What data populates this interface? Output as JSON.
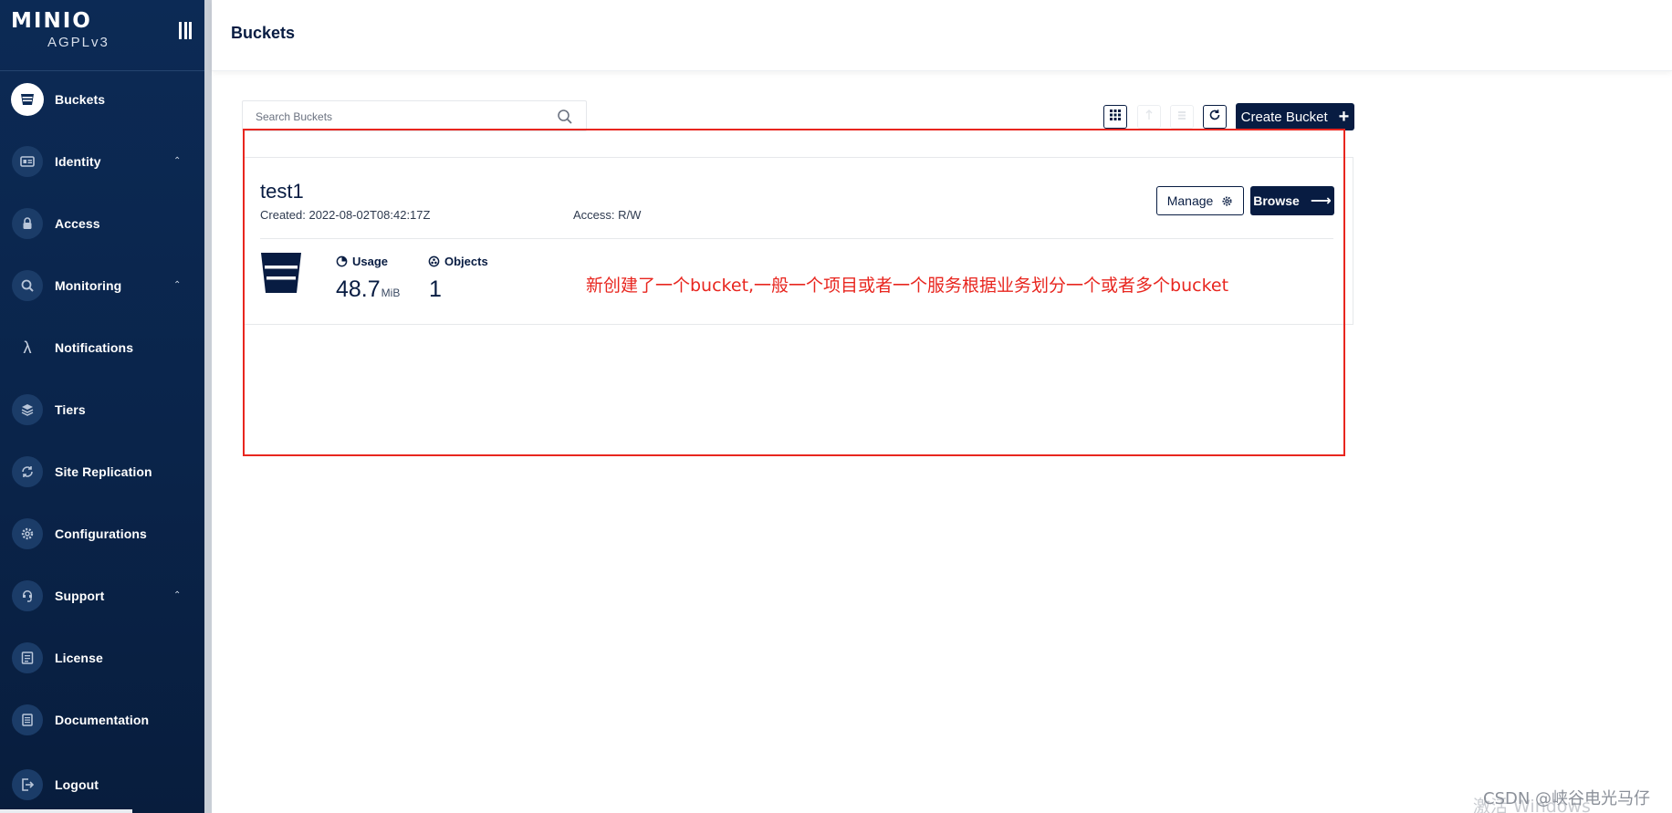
{
  "app": {
    "logo_text": "MINIO",
    "edition": "AGPLv3"
  },
  "sidebar": {
    "items": [
      {
        "label": "Buckets",
        "icon": "bucket-icon",
        "active": true
      },
      {
        "label": "Identity",
        "icon": "id-card-icon",
        "expandable": true
      },
      {
        "label": "Access",
        "icon": "lock-icon"
      },
      {
        "label": "Monitoring",
        "icon": "monitor-search-icon",
        "expandable": true
      },
      {
        "label": "Notifications",
        "icon": "lambda-icon"
      },
      {
        "label": "Tiers",
        "icon": "layers-icon"
      },
      {
        "label": "Site Replication",
        "icon": "sync-icon"
      },
      {
        "label": "Configurations",
        "icon": "gear-icon"
      },
      {
        "label": "Support",
        "icon": "support-icon",
        "expandable": true
      },
      {
        "label": "License",
        "icon": "license-icon"
      },
      {
        "label": "Documentation",
        "icon": "document-icon"
      },
      {
        "label": "Logout",
        "icon": "logout-icon"
      }
    ]
  },
  "header": {
    "title": "Buckets"
  },
  "toolbar": {
    "search_placeholder": "Search Buckets",
    "create_label": "Create Bucket"
  },
  "bucket": {
    "name": "test1",
    "created": "Created: 2022-08-02T08:42:17Z",
    "access": "Access: R/W",
    "manage_label": "Manage",
    "browse_label": "Browse",
    "usage_label": "Usage",
    "usage_value": "48.7",
    "usage_unit": "MiB",
    "objects_label": "Objects",
    "objects_value": "1"
  },
  "annotation": {
    "text": "新创建了一个bucket,一般一个项目或者一个服务根据业务划分一个或者多个bucket",
    "color": "#e8261f"
  },
  "watermarks": {
    "csdn": "CSDN @峡谷电光马仔",
    "activate": "激活 Windows"
  },
  "colors": {
    "sidebar_bg": "#0c2a55",
    "primary": "#081c42"
  }
}
